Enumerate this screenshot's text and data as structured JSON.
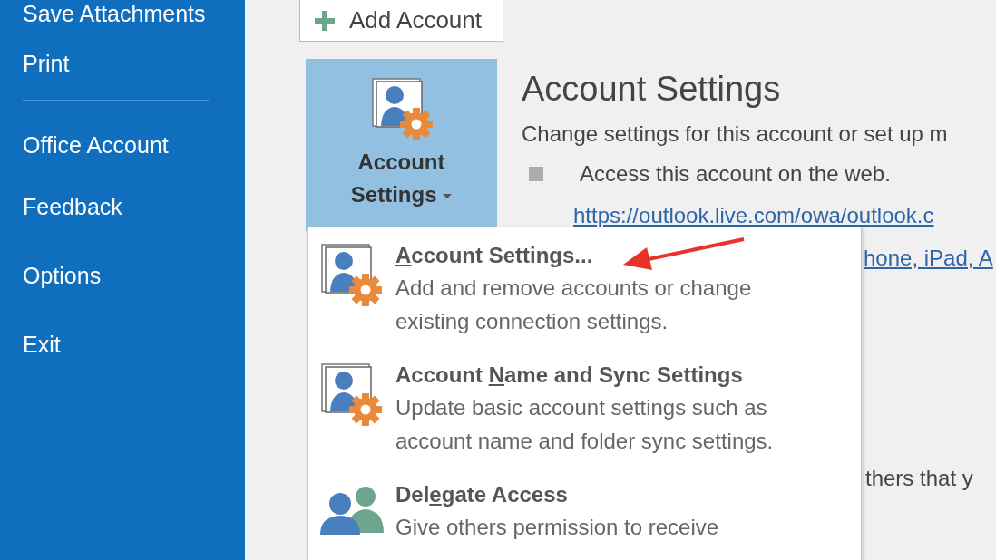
{
  "sidebar": {
    "items": [
      {
        "label": "Save Attachments",
        "kind": "item"
      },
      {
        "label": "Print",
        "kind": "item"
      },
      {
        "kind": "separator"
      },
      {
        "label": "Office Account",
        "kind": "item"
      },
      {
        "label": "Feedback",
        "kind": "item"
      },
      {
        "label": "Options",
        "kind": "item"
      },
      {
        "label": "Exit",
        "kind": "item"
      }
    ]
  },
  "add_account_button": {
    "label": "Add Account"
  },
  "account_settings_button": {
    "label": "Account Settings",
    "expanded": true
  },
  "section": {
    "title": "Account Settings",
    "description": "Change settings for this account or set up m",
    "bullet_text": "Access this account on the web.",
    "link": "https://outlook.live.com/owa/outlook.c",
    "partial_link": "hone, iPad, A",
    "partial_text": "thers that y"
  },
  "menu": {
    "items": [
      {
        "kind": "settings",
        "access_key": "A",
        "title_end": "ccount Settings...",
        "description": "Add and remove accounts or change existing connection settings."
      },
      {
        "kind": "settings",
        "title_start": "Account ",
        "access_key": "N",
        "title_end": "ame and Sync Settings",
        "description": "Update basic account settings such as account name and folder sync settings."
      },
      {
        "kind": "delegate",
        "title_start": "Del",
        "access_key": "e",
        "title_end": "gate Access",
        "description": "Give others permission to receive"
      }
    ]
  }
}
